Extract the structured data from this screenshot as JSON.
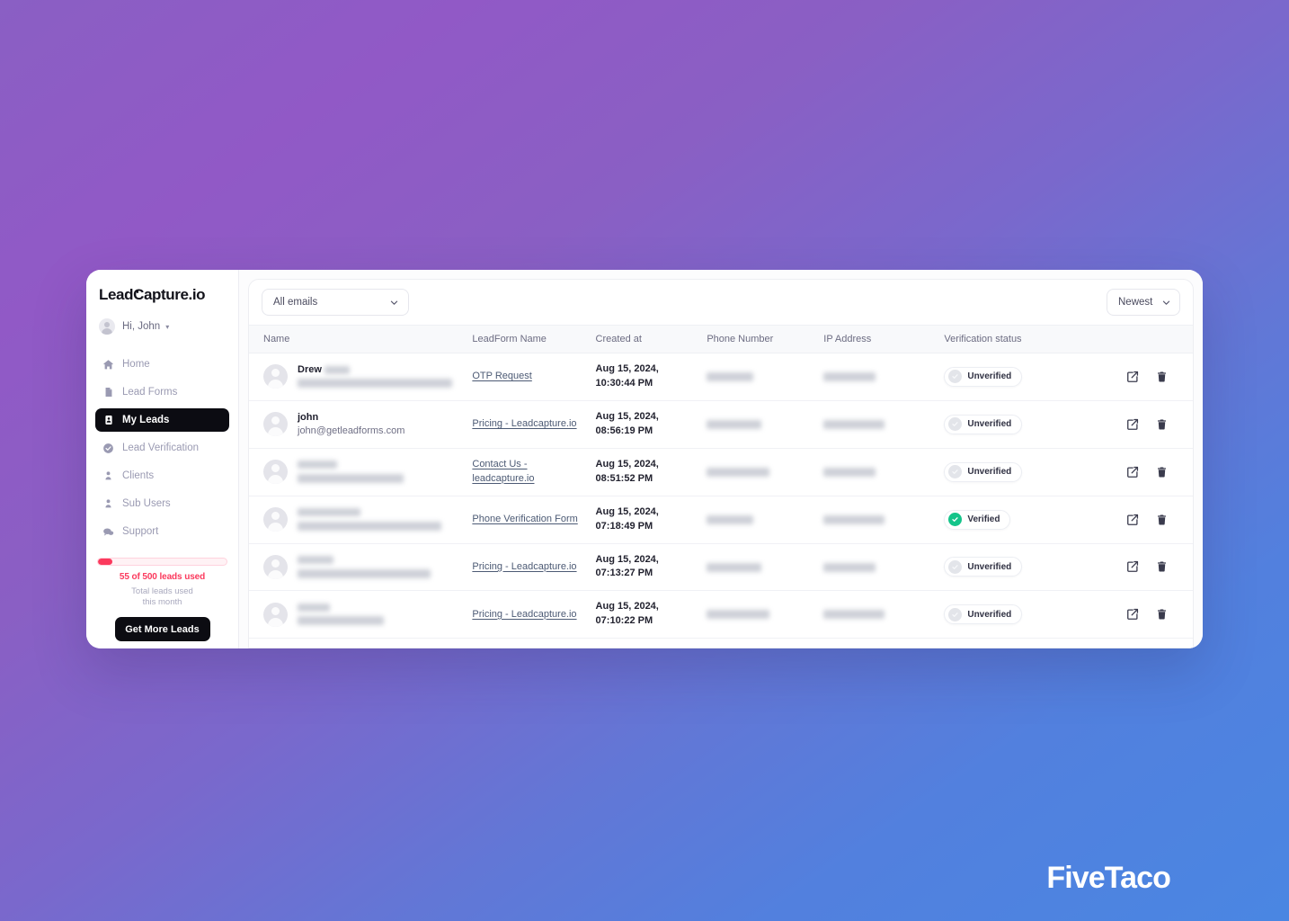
{
  "background": {
    "gradient_from": "#8a5fc4",
    "gradient_mid": "#7a68cc",
    "gradient_to": "#4a86e2"
  },
  "watermark": {
    "text": "FiveTaco"
  },
  "sidebar": {
    "brand": {
      "before_c": "Lead",
      "c": "C",
      "after_c": "apture.io"
    },
    "user": {
      "greeting": "Hi, John",
      "caret": "▾",
      "avatar_icon": "user-avatar-icon"
    },
    "nav_items": [
      {
        "label": "Home",
        "icon": "home-icon",
        "active": false
      },
      {
        "label": "Lead Forms",
        "icon": "document-icon",
        "active": false
      },
      {
        "label": "My Leads",
        "icon": "contact-card-icon",
        "active": true
      },
      {
        "label": "Lead Verification",
        "icon": "check-circle-icon",
        "active": false
      },
      {
        "label": "Clients",
        "icon": "person-icon",
        "active": false
      },
      {
        "label": "Sub Users",
        "icon": "person-icon",
        "active": false
      },
      {
        "label": "Support",
        "icon": "chat-bubble-icon",
        "active": false
      }
    ],
    "quota": {
      "used": 55,
      "total": 500,
      "percent": 11,
      "label": "55 of 500 leads used",
      "sub_line1": "Total leads used",
      "sub_line2": "this month",
      "accent_color": "#fb3a5d",
      "cta_label": "Get More Leads"
    }
  },
  "toolbar": {
    "email_filter": {
      "value": "All emails",
      "icon": "chevron-down-icon"
    },
    "sort": {
      "value": "Newest",
      "icon": "chevron-down-icon"
    }
  },
  "table": {
    "columns": [
      "Name",
      "LeadForm Name",
      "Created at",
      "Phone Number",
      "IP Address",
      "Verification status",
      ""
    ],
    "rows": [
      {
        "name_primary": "Drew",
        "name_primary_redacted": true,
        "name_secondary": "",
        "name_secondary_redacted": true,
        "form_name": "OTP Request",
        "created_at_line1": "Aug 15, 2024,",
        "created_at_line2": "10:30:44 PM",
        "phone_redacted": true,
        "ip_redacted": true,
        "status": "Unverified",
        "status_state": "unverified"
      },
      {
        "name_primary": "john",
        "name_primary_redacted": false,
        "name_secondary": "john@getleadforms.com",
        "name_secondary_redacted": false,
        "form_name": "Pricing - Leadcapture.io",
        "created_at_line1": "Aug 15, 2024,",
        "created_at_line2": "08:56:19 PM",
        "phone_redacted": true,
        "ip_redacted": true,
        "status": "Unverified",
        "status_state": "unverified"
      },
      {
        "name_primary": "",
        "name_primary_redacted": true,
        "name_secondary": "",
        "name_secondary_redacted": true,
        "form_name": "Contact Us - leadcapture.io",
        "created_at_line1": "Aug 15, 2024,",
        "created_at_line2": "08:51:52 PM",
        "phone_redacted": true,
        "ip_redacted": true,
        "status": "Unverified",
        "status_state": "unverified"
      },
      {
        "name_primary": "",
        "name_primary_redacted": true,
        "name_secondary": "",
        "name_secondary_redacted": true,
        "form_name": "Phone Verification Form",
        "created_at_line1": "Aug 15, 2024,",
        "created_at_line2": "07:18:49 PM",
        "phone_redacted": true,
        "ip_redacted": true,
        "status": "Verified",
        "status_state": "verified"
      },
      {
        "name_primary": "",
        "name_primary_redacted": true,
        "name_secondary": "",
        "name_secondary_redacted": true,
        "form_name": "Pricing - Leadcapture.io",
        "created_at_line1": "Aug 15, 2024,",
        "created_at_line2": "07:13:27 PM",
        "phone_redacted": true,
        "ip_redacted": true,
        "status": "Unverified",
        "status_state": "unverified"
      },
      {
        "name_primary": "",
        "name_primary_redacted": true,
        "name_secondary": "",
        "name_secondary_redacted": true,
        "form_name": "Pricing - Leadcapture.io",
        "created_at_line1": "Aug 15, 2024,",
        "created_at_line2": "07:10:22 PM",
        "phone_redacted": true,
        "ip_redacted": true,
        "status": "Unverified",
        "status_state": "unverified"
      }
    ],
    "row_actions": [
      {
        "label": "Open",
        "icon": "external-link-icon"
      },
      {
        "label": "Delete",
        "icon": "trash-icon"
      }
    ],
    "status_colors": {
      "verified": "#14c48a",
      "unverified": "#e3e5ea"
    }
  }
}
